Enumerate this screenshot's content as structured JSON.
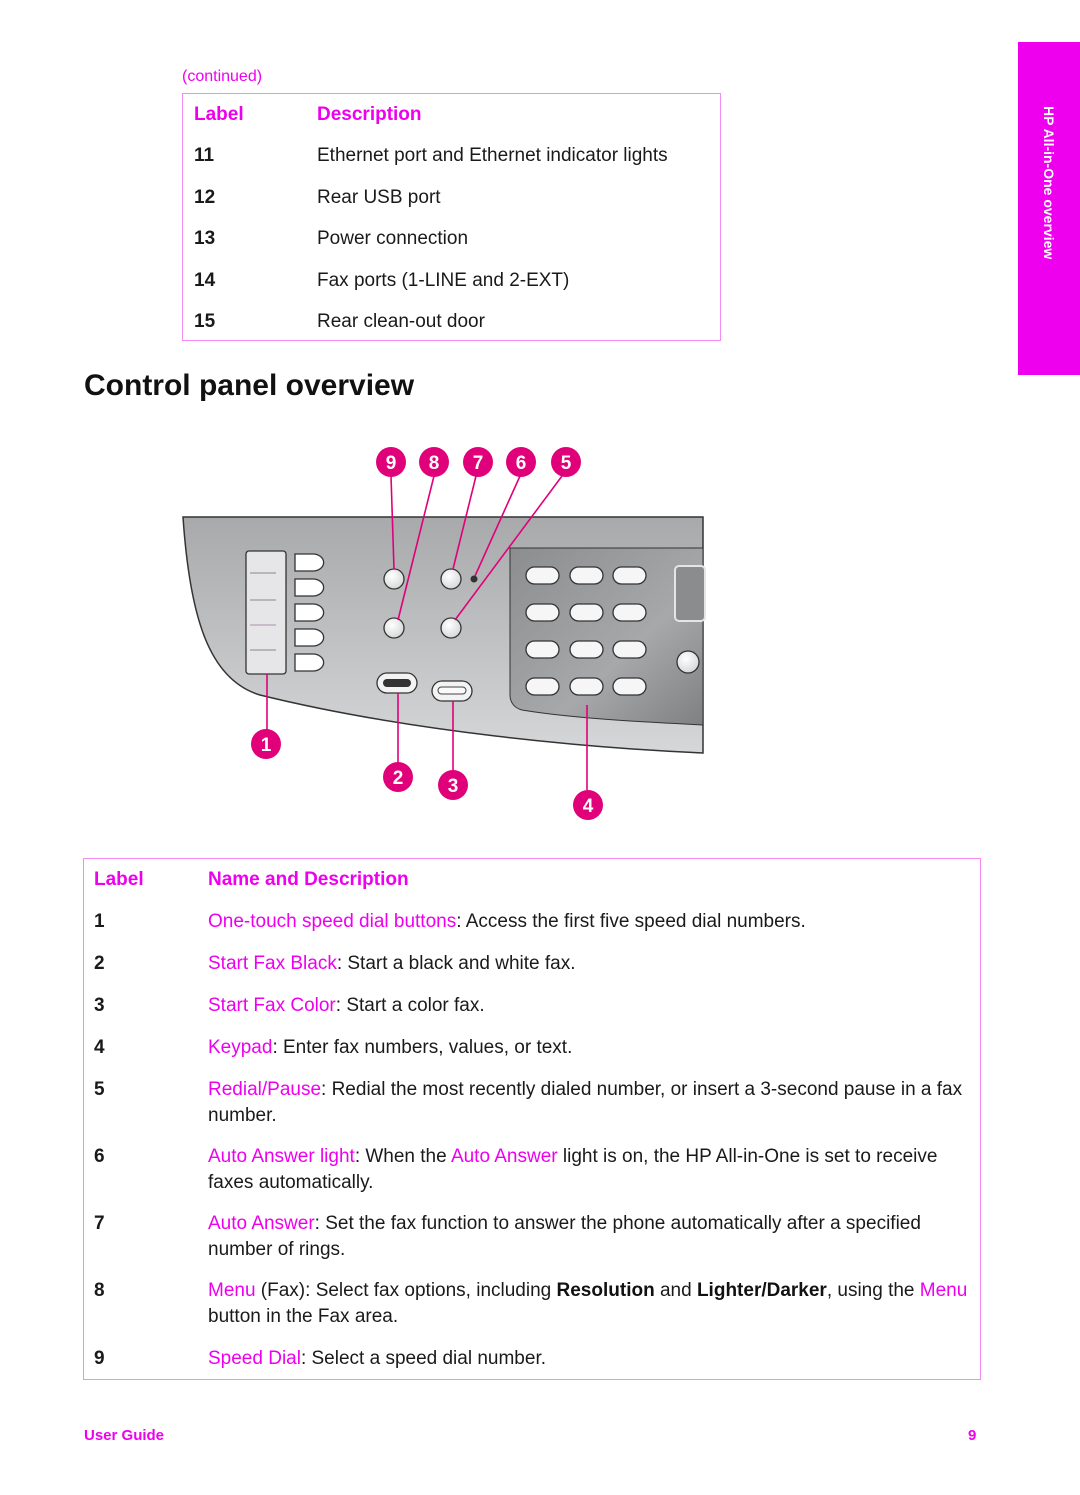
{
  "continued_note": "(continued)",
  "rear_table": {
    "headers": {
      "label": "Label",
      "description": "Description"
    },
    "rows": [
      {
        "label": "11",
        "description": "Ethernet port and Ethernet indicator lights"
      },
      {
        "label": "12",
        "description": "Rear USB port"
      },
      {
        "label": "13",
        "description": "Power connection"
      },
      {
        "label": "14",
        "description": "Fax ports (1-LINE and 2-EXT)"
      },
      {
        "label": "15",
        "description": "Rear clean-out door"
      }
    ]
  },
  "side_tab": {
    "text": "HP All-in-One overview"
  },
  "section_title": "Control panel overview",
  "diagram": {
    "callouts": [
      "1",
      "2",
      "3",
      "4",
      "5",
      "6",
      "7",
      "8",
      "9"
    ]
  },
  "control_table": {
    "headers": {
      "label": "Label",
      "description": "Name and Description"
    },
    "rows": [
      {
        "label": "1",
        "name": "One-touch speed dial buttons",
        "text": ": Access the first five speed dial numbers."
      },
      {
        "label": "2",
        "name": "Start Fax Black",
        "text": ": Start a black and white fax."
      },
      {
        "label": "3",
        "name": "Start Fax Color",
        "text": ": Start a color fax."
      },
      {
        "label": "4",
        "name": "Keypad",
        "text": ": Enter fax numbers, values, or text."
      },
      {
        "label": "5",
        "name": "Redial/Pause",
        "text": ": Redial the most recently dialed number, or insert a 3-second pause in a fax number."
      },
      {
        "label": "6",
        "name": "Auto Answer light",
        "text_a": ": When the ",
        "name_b": "Auto Answer",
        "text_b": " light is on, the HP All-in-One is set to receive faxes automatically."
      },
      {
        "label": "7",
        "name": "Auto Answer",
        "text": ": Set the fax function to answer the phone automatically after a specified number of rings."
      },
      {
        "label": "8",
        "name": "Menu",
        "text_a": " (Fax): Select fax options, including ",
        "bold_a": "Resolution",
        "text_b": " and ",
        "bold_b": "Lighter/Darker",
        "text_c": ", using the ",
        "name_b": "Menu",
        "text_d": " button in the Fax area."
      },
      {
        "label": "9",
        "name": "Speed Dial",
        "text": ": Select a speed dial number."
      }
    ]
  },
  "footer": {
    "left": "User Guide",
    "page_number": "9"
  },
  "colors": {
    "accent": "#ee00ee",
    "table_border": "#f58cf5",
    "panel_gray": "#c8c9cb",
    "keypad_gray": "#9a9b9d"
  }
}
